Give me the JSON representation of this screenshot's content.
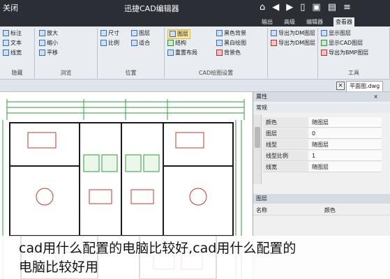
{
  "titlebar": {
    "left_text": "关闭",
    "title": "迅捷CAD编辑器",
    "icons": [
      "home-icon",
      "back-icon",
      "forward-icon",
      "file-icon",
      "save-icon",
      "print-icon",
      "menu-icon"
    ]
  },
  "tabs": [
    "查看器",
    "编辑器",
    "高级",
    "输出"
  ],
  "ribbon": {
    "groups": [
      {
        "label": "工具",
        "items": [
          "显示图层",
          "显示CAD图层",
          "导出为BMP图层",
          "导出为DM图层",
          "导出为DM图层"
        ]
      },
      {
        "label": "CAD绘图设置",
        "items": [
          "黑色背景",
          "黑白绘图",
          "背景色",
          "图层",
          "结构",
          "重置布局"
        ]
      },
      {
        "label": "位置",
        "items": [
          "尺寸",
          "图层",
          "比例",
          "适合"
        ]
      },
      {
        "label": "浏览",
        "items": [
          "放大",
          "缩小",
          "平移"
        ]
      },
      {
        "label": "隐藏",
        "items": [
          "标注",
          "文本",
          "线宽"
        ]
      }
    ]
  },
  "doc_tab": {
    "close": "×",
    "name": "平面图.dwg"
  },
  "panel": {
    "sections": [
      "属性",
      "常规"
    ],
    "rows": [
      {
        "key": "颜色",
        "value": "随图层"
      },
      {
        "key": "图层",
        "value": "0"
      },
      {
        "key": "线型",
        "value": "随图层"
      },
      {
        "key": "线型比例",
        "value": "1"
      },
      {
        "key": "线宽",
        "value": "随图层"
      }
    ],
    "lower_header": "图层",
    "lower_cols": [
      "名称",
      "颜色"
    ]
  },
  "caption": {
    "line1": "cad用什么配置的电脑比较好,cad用什么配置的",
    "line2": "电脑比较好用"
  },
  "colors": {
    "titlebar": "#2b2f35",
    "ribbon": "#e9edf2",
    "drawing_lines": "#2e9b3a",
    "walls": "#1a1a1a",
    "furniture_red": "#c0392b",
    "accent_blue": "#3b6ea8"
  }
}
